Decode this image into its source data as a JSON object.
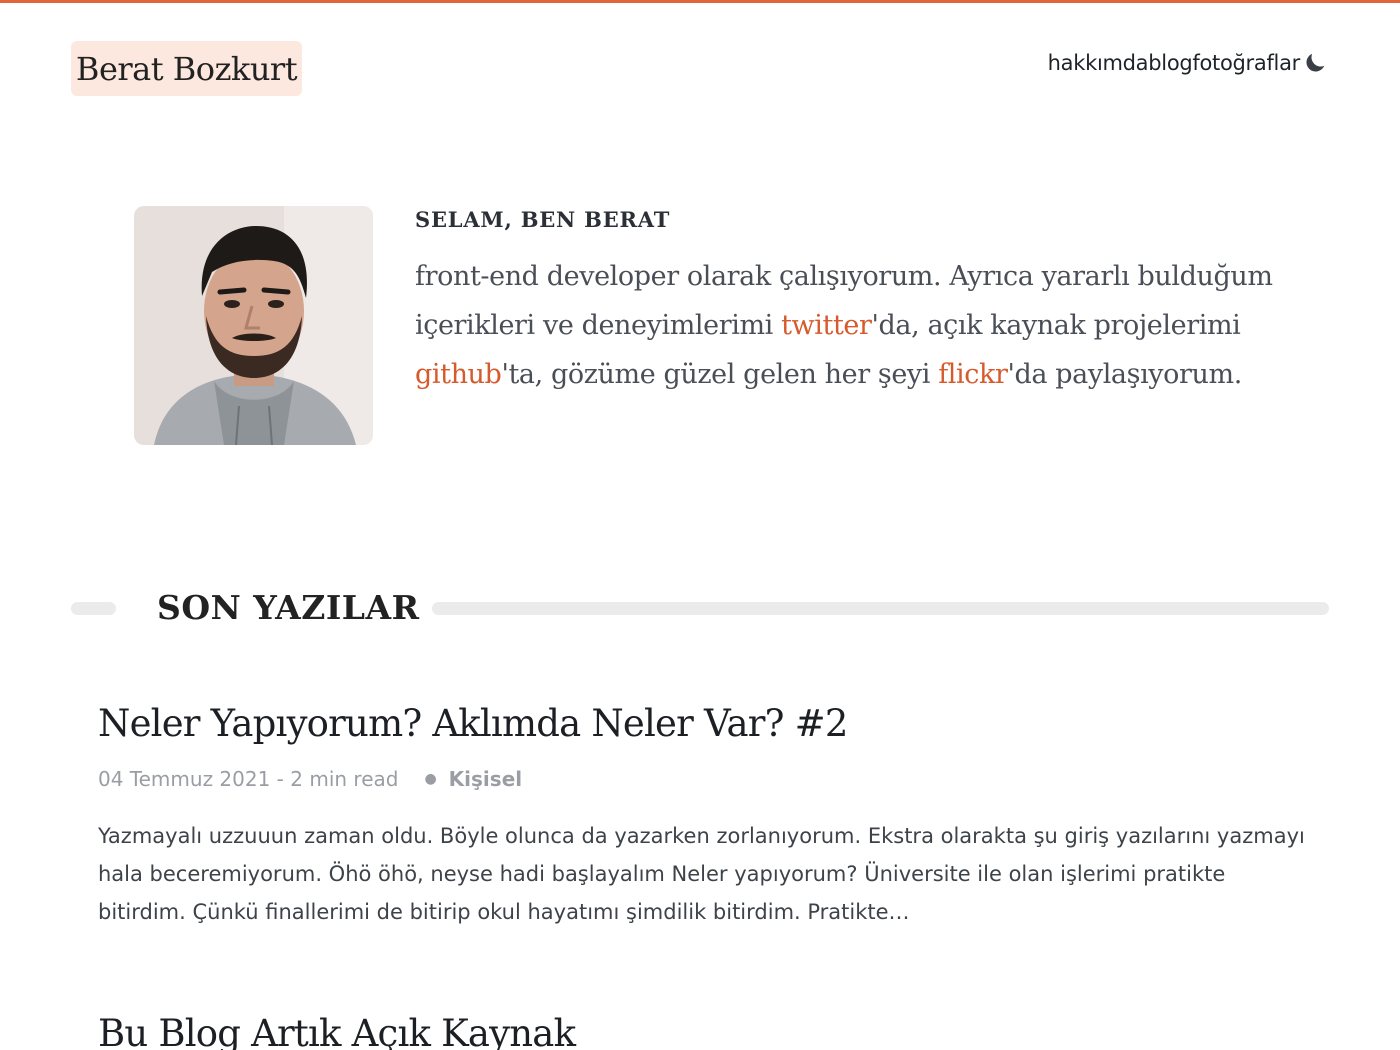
{
  "header": {
    "brand": "Berat Bozkurt",
    "nav": [
      {
        "label": "hakkımda"
      },
      {
        "label": "blog"
      },
      {
        "label": "fotoğraflar"
      }
    ],
    "theme_toggle_icon": "moon-icon"
  },
  "intro": {
    "eyebrow": "SELAM, BEN BERAT",
    "text_1": "front-end developer olarak çalışıyorum. Ayrıca yararlı bulduğum içerikleri ve deneyimlerimi ",
    "link_twitter": "twitter",
    "text_2": "'da, açık kaynak projelerimi ",
    "link_github": "github",
    "text_3": "'ta, gözüme güzel gelen her şeyi ",
    "link_flickr": "flickr",
    "text_4": "'da paylaşıyorum."
  },
  "section": {
    "title": "SON YAZILAR"
  },
  "posts": [
    {
      "title": "Neler Yapıyorum? Aklımda Neler Var? #2",
      "date": "04 Temmuz 2021",
      "read_time": "2 min read",
      "meta": "04 Temmuz 2021 - 2 min read",
      "category": "Kişisel",
      "excerpt": "Yazmayalı uzzuuun zaman oldu. Böyle olunca da yazarken zorlanıyorum. Ekstra olarakta şu giriş yazılarını yazmayı hala beceremiyorum. Öhö öhö, neyse hadi başlayalım Neler yapıyorum? Üniversite ile olan işlerimi pratikte bitirdim. Çünkü finallerimi de bitirip okul hayatımı şimdilik bitirdim. Pratikte…"
    },
    {
      "title": "Bu Blog Artık Açık Kaynak"
    }
  ],
  "colors": {
    "accent": "#e0653a",
    "link": "#d65a2c",
    "brand_bg": "#fde8df"
  }
}
